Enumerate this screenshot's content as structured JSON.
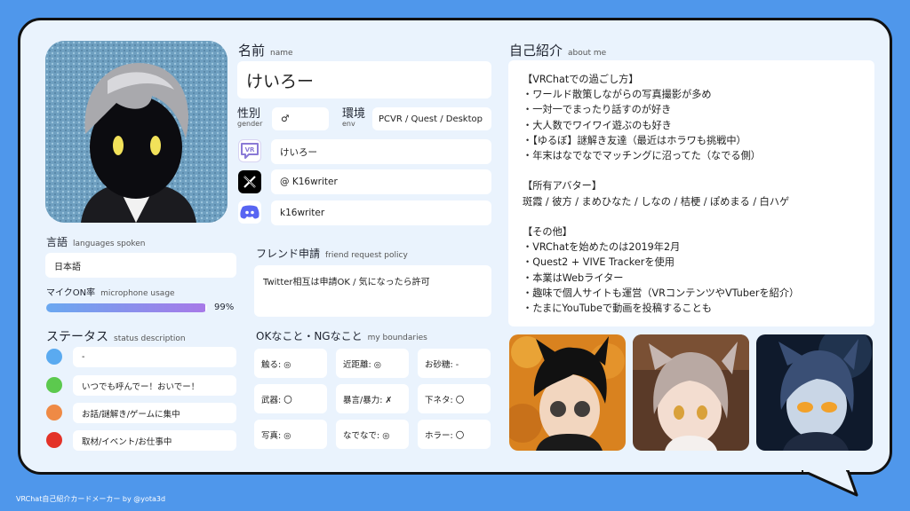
{
  "profile": {
    "name_label": "名前",
    "name_sub": "name",
    "name_value": "けいろー",
    "gender_label": "性別",
    "gender_sub": "gender",
    "gender_value": "♂",
    "env_label": "環境",
    "env_sub": "env",
    "env_value": "PCVR / Quest / Desktop",
    "vrchat_name": "けいろー",
    "x_handle": "@ K16writer",
    "discord_name": "k16writer"
  },
  "languages": {
    "label": "言語",
    "sub": "languages spoken",
    "value": "日本語"
  },
  "mic": {
    "label": "マイクON率",
    "sub": "microphone usage",
    "percent_text": "99%",
    "fraction": 0.99
  },
  "status": {
    "label": "ステータス",
    "sub": "status description",
    "items": [
      {
        "color": "#5aaaf0",
        "text": "-"
      },
      {
        "color": "#5cc94e",
        "text": "いつでも呼んでー！おいでー！"
      },
      {
        "color": "#ef8a45",
        "text": "お話/謎解き/ゲームに集中"
      },
      {
        "color": "#e33228",
        "text": "取材/イベント/お仕事中"
      }
    ]
  },
  "friend": {
    "label": "フレンド申請",
    "sub": "friend request policy",
    "value": "Twitter相互は申請OK / 気になったら許可"
  },
  "boundaries": {
    "label": "OKなこと・NGなこと",
    "sub": "my boundaries",
    "items": [
      "触る: ◎",
      "近距離: ◎",
      "お砂糖: -",
      "武器: 〇",
      "暴言/暴力: ✗",
      "下ネタ: 〇",
      "写真: ◎",
      "なでなで: ◎",
      "ホラー: 〇"
    ]
  },
  "about": {
    "label": "自己紹介",
    "sub": "about me",
    "lines": [
      "【VRChatでの過ごし方】",
      "・ワールド散策しながらの写真撮影が多め",
      "・一対一でまったり話すのが好き",
      "・大人数でワイワイ遊ぶのも好き",
      "・【ゆるぼ】謎解き友達（最近はホラワも挑戦中）",
      "・年末はなでなでマッチングに沼ってた（なでる側）",
      "",
      "【所有アバター】",
      "斑霞 / 彼方 / まめひなた / しなの / 桔梗 / ぽめまる / 白ハゲ",
      "",
      "【その他】",
      "・VRChatを始めたのは2019年2月",
      "・Quest2 + VIVE Trackerを使用",
      "・本業はWebライター",
      "・趣味で個人サイトも運営（VRコンテンツやVTuberを紹介）",
      "・たまにYouTubeで動画を投稿することも"
    ]
  },
  "footer": "VRChat自己紹介カードメーカー by @yota3d",
  "colors": {
    "background": "#4f97eb",
    "card": "#eaf3fd",
    "mic_bar_start": "#6aa8f0",
    "mic_bar_end": "#a779e8",
    "discord": "#5865f2",
    "vrchat": "#8a7ad6"
  }
}
